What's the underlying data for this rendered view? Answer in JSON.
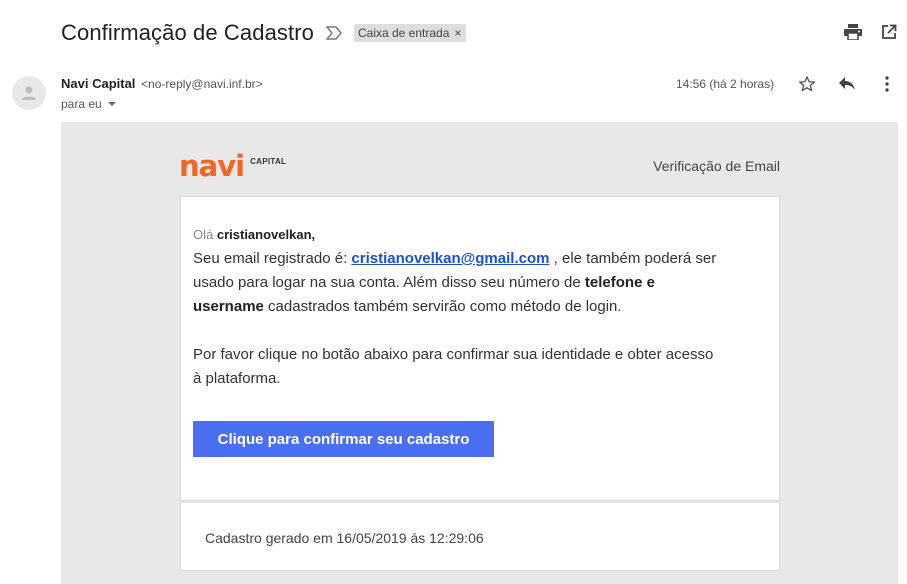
{
  "header": {
    "subject": "Confirmação de Cadastro",
    "label": "Caixa de entrada",
    "label_close": "×"
  },
  "message": {
    "sender_name": "Navi Capital",
    "sender_email": "<no-reply@navi.inf.br>",
    "recipient": "para eu",
    "time": "14:56 (há 2 horas)"
  },
  "email": {
    "logo_text": "navi",
    "logo_sub": "CAPITAL",
    "header_right": "Verificação de Email",
    "greeting_prefix": "Olá",
    "greeting_name": "cristianovelkan,",
    "p1_a": "Seu email registrado é:",
    "p1_email": "cristianovelkan@gmail.com",
    "p1_b": ", ele também poderá ser",
    "p1_c": "usado para logar na sua conta. Além disso seu número de",
    "p1_strong1": "telefone e",
    "p1_strong2": "username",
    "p1_d": "cadastrados também servirão como método de login.",
    "p2_a": "Por favor clique no botão abaixo para confirmar sua identidade e obter acesso",
    "p2_b": "à plataforma.",
    "button": "Clique para confirmar seu cadastro",
    "footer": "Cadastro gerado em 16/05/2019 ás 12:29:06"
  },
  "colors": {
    "brand_orange": "#f26522",
    "button_blue": "#4a6ef0",
    "link_blue": "#1a4fd6"
  }
}
